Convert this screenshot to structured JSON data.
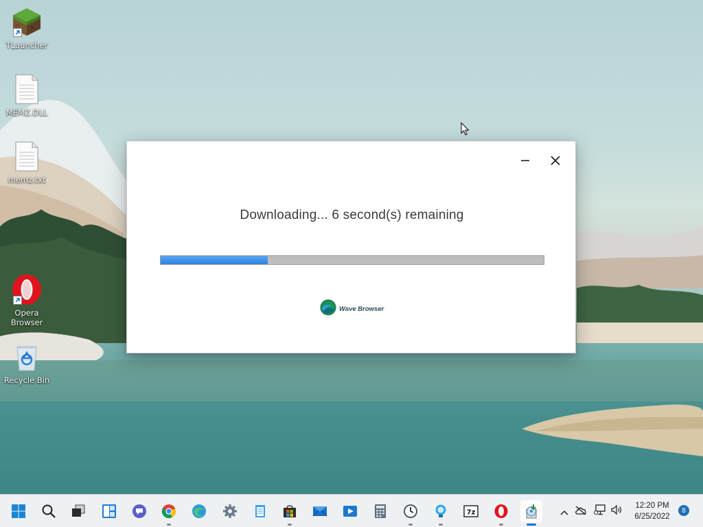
{
  "desktop": {
    "icons": [
      {
        "label": "TLauncher",
        "icon": "minecraft-grass-block-icon",
        "shortcut": true
      },
      {
        "label": "MEMZ.DLL",
        "icon": "file-icon",
        "shortcut": false
      },
      {
        "label": "memz.txt",
        "icon": "text-file-icon",
        "shortcut": false
      },
      {
        "label": "Opera Browser",
        "icon": "opera-icon",
        "shortcut": true
      },
      {
        "label": "Recycle Bin",
        "icon": "recycle-bin-icon",
        "shortcut": false
      }
    ]
  },
  "dialog": {
    "status_text": "Downloading... 6 second(s) remaining",
    "progress_percent": 28,
    "brand_name": "Wave Browser",
    "progress_color": "#3a8ae8",
    "minimize_icon": "minimize-icon",
    "close_icon": "close-icon"
  },
  "taskbar": {
    "apps": [
      {
        "name": "Start",
        "icon": "windows-start-icon"
      },
      {
        "name": "Search",
        "icon": "search-icon"
      },
      {
        "name": "Task View",
        "icon": "task-view-icon"
      },
      {
        "name": "Widgets",
        "icon": "widgets-icon"
      },
      {
        "name": "Chat",
        "icon": "teams-chat-icon"
      },
      {
        "name": "Chrome",
        "icon": "chrome-icon"
      },
      {
        "name": "Edge",
        "icon": "edge-icon"
      },
      {
        "name": "Settings",
        "icon": "gear-icon"
      },
      {
        "name": "Notepad",
        "icon": "notepad-icon"
      },
      {
        "name": "Store",
        "icon": "store-icon"
      },
      {
        "name": "Mail",
        "icon": "mail-icon"
      },
      {
        "name": "Media Player",
        "icon": "media-player-icon"
      },
      {
        "name": "Calculator",
        "icon": "calculator-icon"
      },
      {
        "name": "Clock",
        "icon": "clock-icon"
      },
      {
        "name": "Tips",
        "icon": "tips-icon"
      },
      {
        "name": "7-Zip",
        "icon": "7zip-icon"
      },
      {
        "name": "Opera",
        "icon": "opera-icon"
      },
      {
        "name": "Installer",
        "icon": "installer-icon"
      }
    ],
    "tray": {
      "clock_time": "12:20 PM",
      "clock_date": "6/25/2022",
      "notification_count": "8"
    }
  }
}
